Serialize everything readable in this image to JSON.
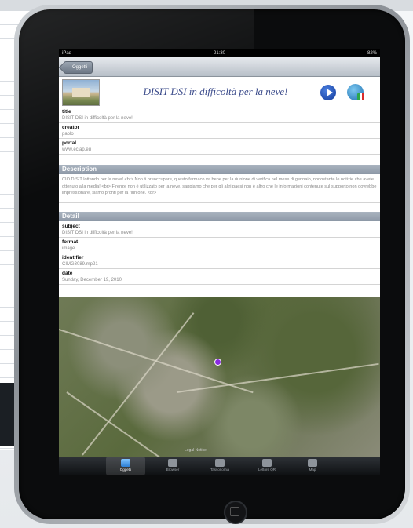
{
  "status_bar": {
    "carrier": "iPad",
    "time": "21:30",
    "battery": "82%"
  },
  "nav": {
    "back_label": "Oggetti"
  },
  "header": {
    "title": "DISIT DSI in difficoltà per la neve!"
  },
  "fields": [
    {
      "label": "title",
      "value": "DISIT DSI in difficoltà per la neve!"
    },
    {
      "label": "creator",
      "value": "paolo"
    },
    {
      "label": "portal",
      "value": "www.eclap.eu"
    }
  ],
  "description": {
    "heading": "Description",
    "text": "CIO DISIT lottando per la neve! <br> Non ti preoccupare, questo farmaco va bene per la riunione di verifica nel mese di gennaio, nonostante le notizie che avete ottenuto alla media! <br> Firenze non è utilizzato per la neve, sappiamo che per gli altri paesi non è altro che le informazioni contenute sul supporto non dovrebbe impressionare, siamo pronti per la riunione. <br>"
  },
  "detail": {
    "heading": "Detail",
    "fields": [
      {
        "label": "subject",
        "value": "DISIT DSI in difficoltà per la neve!"
      },
      {
        "label": "format",
        "value": "image"
      },
      {
        "label": "identifier",
        "value": "CIMG3089.mp21"
      },
      {
        "label": "date",
        "value": "Sunday, December 19, 2010"
      }
    ]
  },
  "map": {
    "legal": "Legal Notice"
  },
  "tabs": [
    {
      "label": "Oggetti",
      "icon": "objects-icon",
      "active": true
    },
    {
      "label": "Browser",
      "icon": "browser-icon",
      "active": false
    },
    {
      "label": "Tassonomia",
      "icon": "taxonomy-icon",
      "active": false
    },
    {
      "label": "Lettore QR",
      "icon": "qr-reader-icon",
      "active": false
    },
    {
      "label": "Map",
      "icon": "map-icon",
      "active": false
    }
  ],
  "colors": {
    "title_blue": "#3a4a8a",
    "section_bar": "#8d98a6",
    "tab_active": "#2d7fd6"
  }
}
